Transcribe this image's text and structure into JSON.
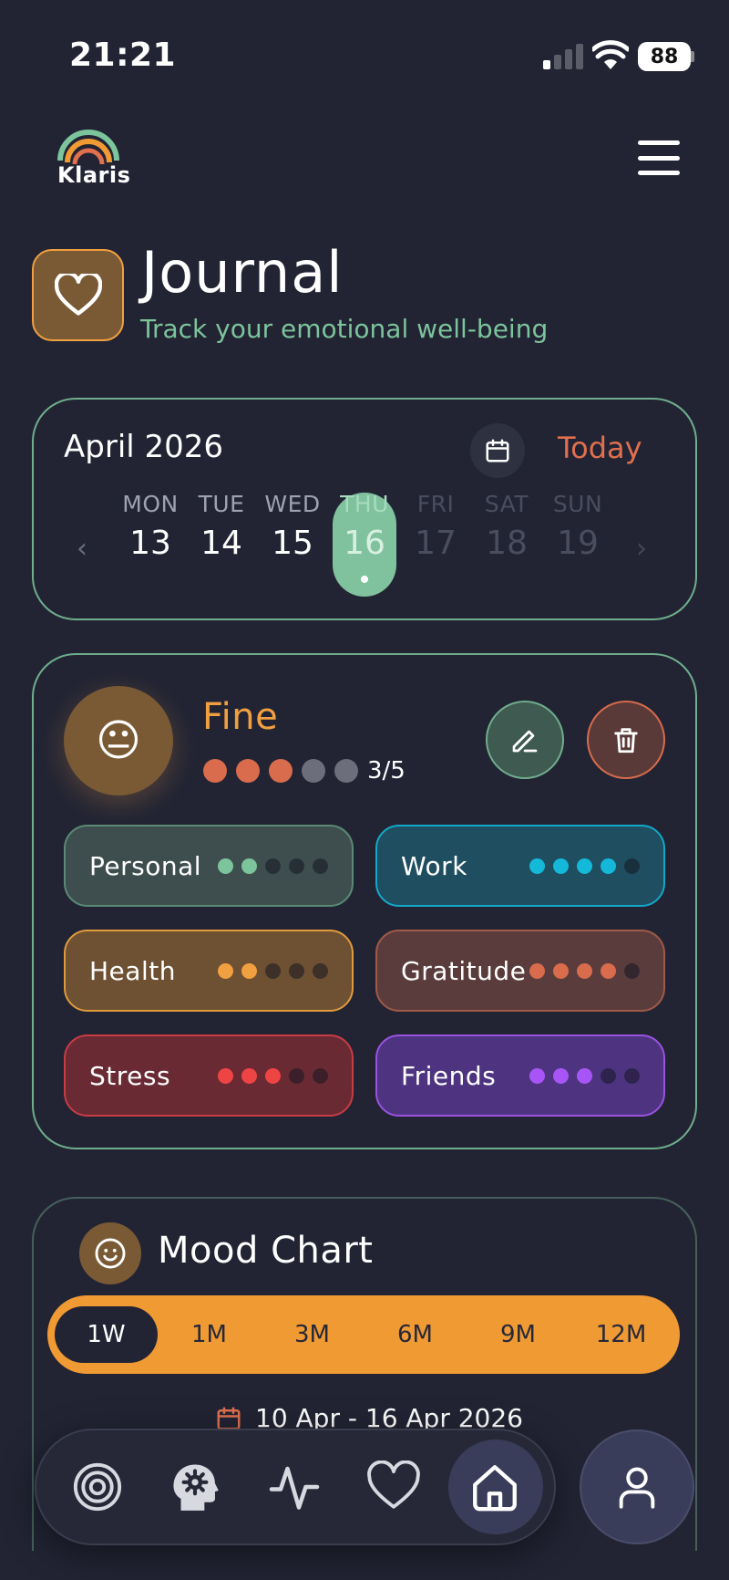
{
  "status_bar": {
    "time": "21:21",
    "battery": "88"
  },
  "header": {
    "logo_text": "Klaris"
  },
  "title": {
    "heading": "Journal",
    "subtitle": "Track your emotional well-being"
  },
  "calendar": {
    "month": "April 2026",
    "today_label": "Today",
    "days": [
      {
        "name": "MON",
        "date": "13"
      },
      {
        "name": "TUE",
        "date": "14"
      },
      {
        "name": "WED",
        "date": "15"
      },
      {
        "name": "THU",
        "date": "16"
      },
      {
        "name": "FRI",
        "date": "17"
      },
      {
        "name": "SAT",
        "date": "18"
      },
      {
        "name": "SUN",
        "date": "19"
      }
    ],
    "selected_day": "THU"
  },
  "mood": {
    "emoji": "😐",
    "label": "Fine",
    "score": "3/5",
    "rating": 3,
    "max": 5
  },
  "tags": [
    {
      "label": "Personal",
      "level": 2,
      "color": "#7cc49b",
      "bg": "#3e4e4e",
      "border": "#5a8a74"
    },
    {
      "label": "Work",
      "level": 4,
      "color": "#14b8d8",
      "bg": "#1e4e60",
      "border": "#14a8c8"
    },
    {
      "label": "Health",
      "level": 2,
      "color": "#f0a040",
      "bg": "#6e5032",
      "border": "#e09a3c"
    },
    {
      "label": "Gratitude",
      "level": 4,
      "color": "#d86c4c",
      "bg": "#5a3c3c",
      "border": "#a05a48"
    },
    {
      "label": "Stress",
      "level": 3,
      "color": "#ee4444",
      "bg": "#6a2a34",
      "border": "#c83c44"
    },
    {
      "label": "Friends",
      "level": 3,
      "color": "#a855f7",
      "bg": "#4e3480",
      "border": "#9a52e0"
    }
  ],
  "chart": {
    "title": "Mood Chart",
    "ranges": [
      "1W",
      "1M",
      "3M",
      "6M",
      "9M",
      "12M"
    ],
    "active_range": "1W",
    "date_range": "10 Apr - 16 Apr 2026"
  },
  "colors": {
    "accent_green": "#7cc49b",
    "accent_orange": "#f09a34",
    "accent_red": "#e0704e",
    "background": "#222434"
  },
  "nav": {
    "items": [
      "target-icon",
      "brain-gear-icon",
      "pulse-icon",
      "heart-icon",
      "home-icon"
    ],
    "active": "home-icon",
    "profile": "user-icon"
  }
}
